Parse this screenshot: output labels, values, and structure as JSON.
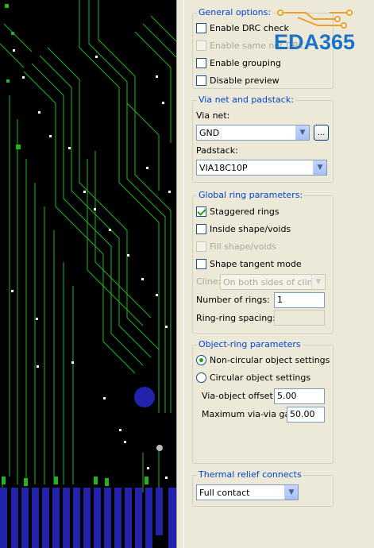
{
  "logo": {
    "text": "EDA365"
  },
  "general": {
    "title": "General options:",
    "items": [
      {
        "label": "Enable DRC check",
        "checked": false,
        "enabled": true
      },
      {
        "label": "Enable same net DRC",
        "checked": false,
        "enabled": false
      },
      {
        "label": "Enable grouping",
        "checked": false,
        "enabled": true
      },
      {
        "label": "Disable preview",
        "checked": false,
        "enabled": true
      }
    ]
  },
  "via_padstack": {
    "title": "Via net and padstack:",
    "via_net_label": "Via net:",
    "via_net_value": "GND",
    "browse_label": "...",
    "padstack_label": "Padstack:",
    "padstack_value": "VIA18C10P"
  },
  "global_ring": {
    "title": "Global ring parameters:",
    "items": [
      {
        "label": "Staggered rings",
        "checked": true,
        "enabled": true
      },
      {
        "label": "Inside shape/voids",
        "checked": false,
        "enabled": true
      },
      {
        "label": "Fill shape/voids",
        "checked": false,
        "enabled": false
      },
      {
        "label": "Shape tangent mode",
        "checked": false,
        "enabled": true
      }
    ],
    "cline_label": "Cline:",
    "cline_value": "On both sides of cline",
    "num_rings_label": "Number of rings:",
    "num_rings_value": "1",
    "ring_spacing_label": "Ring-ring spacing:",
    "ring_spacing_value": ""
  },
  "object_ring": {
    "title": "Object-ring parameters",
    "options": [
      {
        "label": "Non-circular object settings",
        "selected": true
      },
      {
        "label": "Circular object settings",
        "selected": false
      }
    ],
    "via_offset_label": "Via-object offset:",
    "via_offset_value": "5.00",
    "max_gap_label": "Maximum via-via gap:",
    "max_gap_value": "50.00"
  },
  "thermal": {
    "title": "Thermal relief connects",
    "value": "Full contact"
  },
  "colors": {
    "panel_bg": "#ece9d8",
    "group_title": "#0046d5",
    "pcb_bg": "#000000",
    "trace": "#22b422",
    "pad": "#2222aa"
  }
}
